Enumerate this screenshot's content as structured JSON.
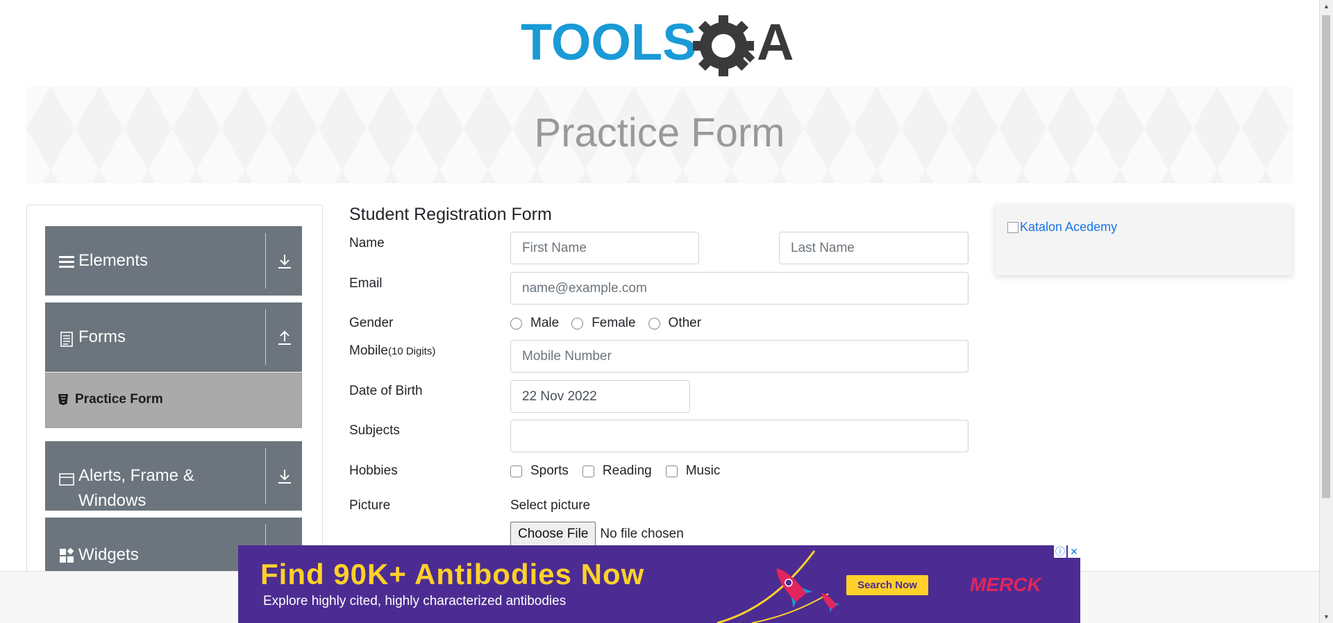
{
  "logo": {
    "text_tools": "TOOLS",
    "text_a": "A"
  },
  "banner": {
    "title": "Practice Form"
  },
  "sidebar": {
    "groups": [
      {
        "label": "Elements",
        "icon": "hamburger-icon",
        "state": "collapsed"
      },
      {
        "label": "Forms",
        "icon": "document-icon",
        "state": "expanded"
      },
      {
        "label": "Alerts, Frame &",
        "label_line2": "Windows",
        "icon": "window-icon",
        "state": "collapsed"
      },
      {
        "label": "Widgets",
        "icon": "widgets-icon",
        "state": "collapsed"
      }
    ],
    "active_item": {
      "label": "Practice Form",
      "icon": "html5-icon"
    }
  },
  "form": {
    "title": "Student Registration Form",
    "name_label": "Name",
    "first_name_placeholder": "First Name",
    "last_name_placeholder": "Last Name",
    "email_label": "Email",
    "email_placeholder": "name@example.com",
    "gender_label": "Gender",
    "gender_options": [
      "Male",
      "Female",
      "Other"
    ],
    "mobile_label": "Mobile",
    "mobile_hint": "(10 Digits)",
    "mobile_placeholder": "Mobile Number",
    "dob_label": "Date of Birth",
    "dob_value": "22 Nov 2022",
    "subjects_label": "Subjects",
    "hobbies_label": "Hobbies",
    "hobbies_options": [
      "Sports",
      "Reading",
      "Music"
    ],
    "picture_label": "Picture",
    "select_picture_label": "Select picture",
    "choose_file_label": "Choose File",
    "no_file_text": "No file chosen"
  },
  "side_ad": {
    "alt_text": "Katalon Acedemy"
  },
  "bottom_ad": {
    "headline": "Find 90K+ Antibodies Now",
    "subline": "Explore highly cited, highly characterized antibodies",
    "cta": "Search Now",
    "brand": "MERCK",
    "colors": {
      "background": "#4c2c92",
      "headline": "#ffd12a",
      "brand": "#e3255e"
    }
  },
  "colors": {
    "sidebar_group": "#6c757d",
    "active_item": "#aaaaaa",
    "logo_blue": "#1a9ad6",
    "logo_gray": "#3a3a3a"
  }
}
